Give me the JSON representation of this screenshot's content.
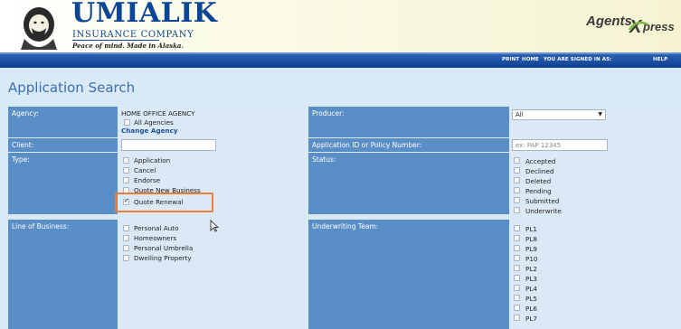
{
  "brand": {
    "title": "UMIALIK",
    "subtitle": "INSURANCE COMPANY",
    "tagline": "Peace of mind. Made in Alaska.",
    "agents_text": "Agents",
    "agents_x": "X",
    "agents_press": "press",
    "agents_tm": "™"
  },
  "nav": {
    "print": "PRINT",
    "home": "HOME",
    "signed_in": "YOU ARE SIGNED IN AS:",
    "help": "HELP"
  },
  "page": {
    "title": "Application Search"
  },
  "form": {
    "agency": {
      "label": "Agency:",
      "value": "HOME OFFICE AGENCY",
      "all_agencies": "All Agencies",
      "change": "Change Agency"
    },
    "producer": {
      "label": "Producer:",
      "selected": "All"
    },
    "client": {
      "label": "Client:",
      "value": ""
    },
    "app_id": {
      "label": "Application ID or Policy Number:",
      "placeholder": "ex: PAP 12345"
    },
    "type": {
      "label": "Type:",
      "options": [
        {
          "label": "Application",
          "checked": false
        },
        {
          "label": "Cancel",
          "checked": false
        },
        {
          "label": "Endorse",
          "checked": false
        },
        {
          "label": "Quote New Business",
          "checked": false
        },
        {
          "label": "Quote Renewal",
          "checked": true
        }
      ]
    },
    "status": {
      "label": "Status:",
      "options": [
        "Accepted",
        "Declined",
        "Deleted",
        "Pending",
        "Submitted",
        "Underwrite"
      ]
    },
    "lob": {
      "label": "Line of Business:",
      "options": [
        "Personal Auto",
        "Homeowners",
        "Personal Umbrella",
        "Dwelling Property"
      ]
    },
    "uw_team": {
      "label": "Underwriting Team:",
      "options": [
        "PL1",
        "PL8",
        "PL9",
        "P10",
        "PL2",
        "PL3",
        "PL4",
        "PL5",
        "PL6",
        "PL7"
      ]
    }
  },
  "colors": {
    "brand_blue": "#0b4596",
    "nav_blue": "#1c4ea1",
    "label_blue": "#5a8ec7",
    "highlight": "#ee7d33"
  }
}
